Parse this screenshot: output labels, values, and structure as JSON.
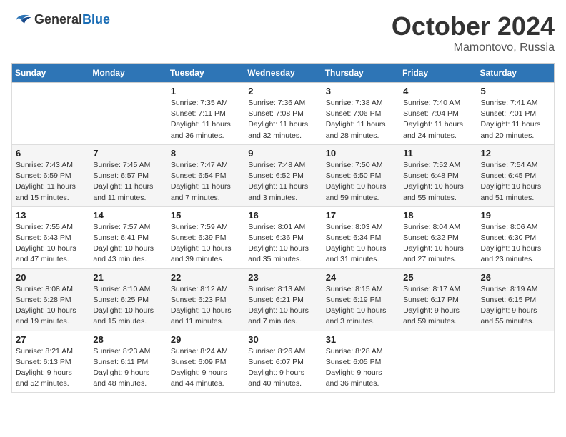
{
  "header": {
    "logo": {
      "general": "General",
      "blue": "Blue"
    },
    "title": "October 2024",
    "location": "Mamontovo, Russia"
  },
  "calendar": {
    "days_of_week": [
      "Sunday",
      "Monday",
      "Tuesday",
      "Wednesday",
      "Thursday",
      "Friday",
      "Saturday"
    ],
    "weeks": [
      [
        {
          "day": "",
          "info": ""
        },
        {
          "day": "",
          "info": ""
        },
        {
          "day": "1",
          "info": "Sunrise: 7:35 AM\nSunset: 7:11 PM\nDaylight: 11 hours and 36 minutes."
        },
        {
          "day": "2",
          "info": "Sunrise: 7:36 AM\nSunset: 7:08 PM\nDaylight: 11 hours and 32 minutes."
        },
        {
          "day": "3",
          "info": "Sunrise: 7:38 AM\nSunset: 7:06 PM\nDaylight: 11 hours and 28 minutes."
        },
        {
          "day": "4",
          "info": "Sunrise: 7:40 AM\nSunset: 7:04 PM\nDaylight: 11 hours and 24 minutes."
        },
        {
          "day": "5",
          "info": "Sunrise: 7:41 AM\nSunset: 7:01 PM\nDaylight: 11 hours and 20 minutes."
        }
      ],
      [
        {
          "day": "6",
          "info": "Sunrise: 7:43 AM\nSunset: 6:59 PM\nDaylight: 11 hours and 15 minutes."
        },
        {
          "day": "7",
          "info": "Sunrise: 7:45 AM\nSunset: 6:57 PM\nDaylight: 11 hours and 11 minutes."
        },
        {
          "day": "8",
          "info": "Sunrise: 7:47 AM\nSunset: 6:54 PM\nDaylight: 11 hours and 7 minutes."
        },
        {
          "day": "9",
          "info": "Sunrise: 7:48 AM\nSunset: 6:52 PM\nDaylight: 11 hours and 3 minutes."
        },
        {
          "day": "10",
          "info": "Sunrise: 7:50 AM\nSunset: 6:50 PM\nDaylight: 10 hours and 59 minutes."
        },
        {
          "day": "11",
          "info": "Sunrise: 7:52 AM\nSunset: 6:48 PM\nDaylight: 10 hours and 55 minutes."
        },
        {
          "day": "12",
          "info": "Sunrise: 7:54 AM\nSunset: 6:45 PM\nDaylight: 10 hours and 51 minutes."
        }
      ],
      [
        {
          "day": "13",
          "info": "Sunrise: 7:55 AM\nSunset: 6:43 PM\nDaylight: 10 hours and 47 minutes."
        },
        {
          "day": "14",
          "info": "Sunrise: 7:57 AM\nSunset: 6:41 PM\nDaylight: 10 hours and 43 minutes."
        },
        {
          "day": "15",
          "info": "Sunrise: 7:59 AM\nSunset: 6:39 PM\nDaylight: 10 hours and 39 minutes."
        },
        {
          "day": "16",
          "info": "Sunrise: 8:01 AM\nSunset: 6:36 PM\nDaylight: 10 hours and 35 minutes."
        },
        {
          "day": "17",
          "info": "Sunrise: 8:03 AM\nSunset: 6:34 PM\nDaylight: 10 hours and 31 minutes."
        },
        {
          "day": "18",
          "info": "Sunrise: 8:04 AM\nSunset: 6:32 PM\nDaylight: 10 hours and 27 minutes."
        },
        {
          "day": "19",
          "info": "Sunrise: 8:06 AM\nSunset: 6:30 PM\nDaylight: 10 hours and 23 minutes."
        }
      ],
      [
        {
          "day": "20",
          "info": "Sunrise: 8:08 AM\nSunset: 6:28 PM\nDaylight: 10 hours and 19 minutes."
        },
        {
          "day": "21",
          "info": "Sunrise: 8:10 AM\nSunset: 6:25 PM\nDaylight: 10 hours and 15 minutes."
        },
        {
          "day": "22",
          "info": "Sunrise: 8:12 AM\nSunset: 6:23 PM\nDaylight: 10 hours and 11 minutes."
        },
        {
          "day": "23",
          "info": "Sunrise: 8:13 AM\nSunset: 6:21 PM\nDaylight: 10 hours and 7 minutes."
        },
        {
          "day": "24",
          "info": "Sunrise: 8:15 AM\nSunset: 6:19 PM\nDaylight: 10 hours and 3 minutes."
        },
        {
          "day": "25",
          "info": "Sunrise: 8:17 AM\nSunset: 6:17 PM\nDaylight: 9 hours and 59 minutes."
        },
        {
          "day": "26",
          "info": "Sunrise: 8:19 AM\nSunset: 6:15 PM\nDaylight: 9 hours and 55 minutes."
        }
      ],
      [
        {
          "day": "27",
          "info": "Sunrise: 8:21 AM\nSunset: 6:13 PM\nDaylight: 9 hours and 52 minutes."
        },
        {
          "day": "28",
          "info": "Sunrise: 8:23 AM\nSunset: 6:11 PM\nDaylight: 9 hours and 48 minutes."
        },
        {
          "day": "29",
          "info": "Sunrise: 8:24 AM\nSunset: 6:09 PM\nDaylight: 9 hours and 44 minutes."
        },
        {
          "day": "30",
          "info": "Sunrise: 8:26 AM\nSunset: 6:07 PM\nDaylight: 9 hours and 40 minutes."
        },
        {
          "day": "31",
          "info": "Sunrise: 8:28 AM\nSunset: 6:05 PM\nDaylight: 9 hours and 36 minutes."
        },
        {
          "day": "",
          "info": ""
        },
        {
          "day": "",
          "info": ""
        }
      ]
    ]
  }
}
